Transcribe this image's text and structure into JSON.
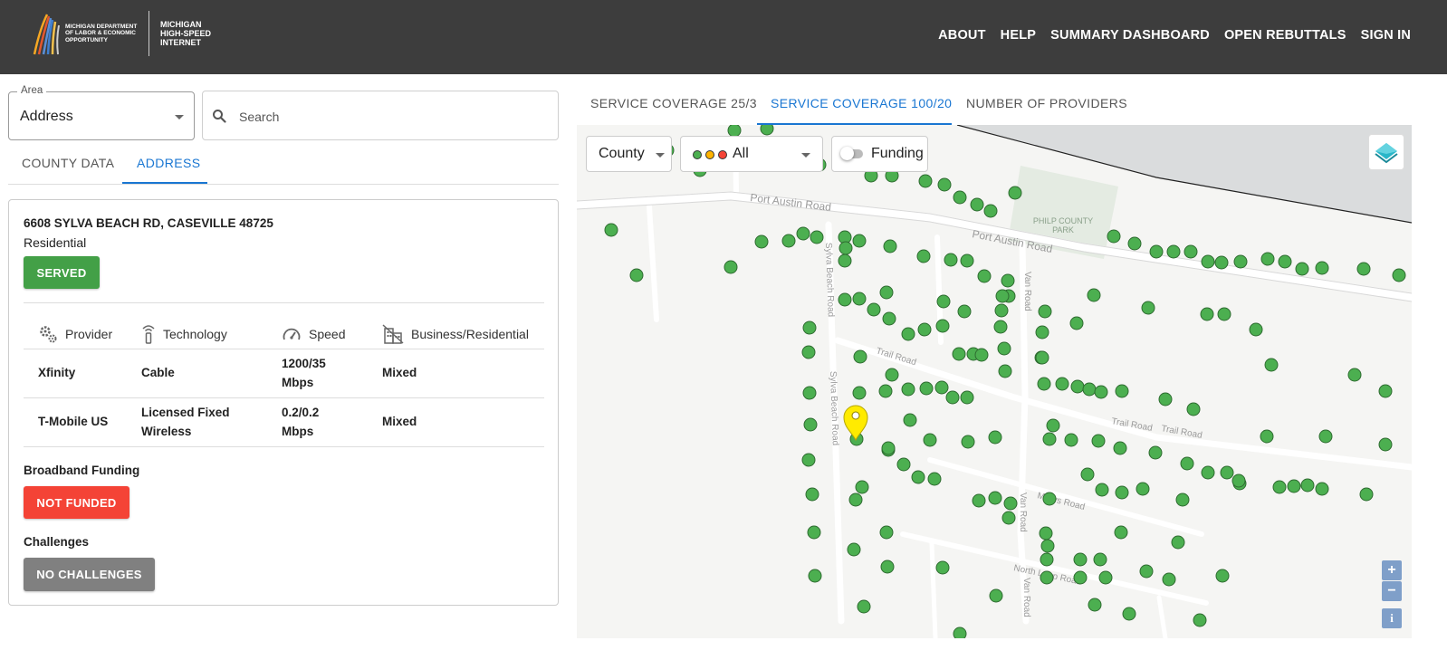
{
  "header": {
    "logo_text_left": "MICHIGAN DEPARTMENT OF LABOR & ECONOMIC OPPORTUNITY",
    "logo_text_right": [
      "MICHIGAN",
      "HIGH-SPEED",
      "INTERNET"
    ],
    "nav": [
      "ABOUT",
      "HELP",
      "SUMMARY DASHBOARD",
      "OPEN REBUTTALS",
      "SIGN IN"
    ]
  },
  "left": {
    "area_label": "Area",
    "area_value": "Address",
    "search_placeholder": "Search",
    "tabs": [
      "COUNTY DATA",
      "ADDRESS"
    ],
    "active_tab": "ADDRESS",
    "card": {
      "address": "6608 SYLVA BEACH RD, CASEVILLE 48725",
      "type": "Residential",
      "status": "SERVED",
      "columns": [
        "Provider",
        "Technology",
        "Speed",
        "Business/Residential"
      ],
      "rows": [
        {
          "provider": "Xfinity",
          "technology": "Cable",
          "speed_1": "1200/35",
          "speed_2": "Mbps",
          "use": "Mixed"
        },
        {
          "provider": "T-Mobile US",
          "technology_1": "Licensed Fixed",
          "technology_2": "Wireless",
          "speed_1": "0.2/0.2",
          "speed_2": "Mbps",
          "use": "Mixed"
        }
      ],
      "funding_title": "Broadband Funding",
      "funding_status": "NOT FUNDED",
      "challenges_title": "Challenges",
      "challenges_status": "NO CHALLENGES"
    }
  },
  "right": {
    "tabs": [
      "SERVICE COVERAGE 25/3",
      "SERVICE COVERAGE 100/20",
      "NUMBER OF PROVIDERS"
    ],
    "active_tab": "SERVICE COVERAGE 100/20",
    "map": {
      "county_select": "County",
      "status_filter": "All",
      "funding_toggle_label": "Funding",
      "funding_toggle_on": false,
      "zoom_in": "+",
      "zoom_out": "−",
      "info": "i",
      "park_label": [
        "PHILP COUNTY",
        "PARK"
      ],
      "streets": {
        "port_austin_1": "Port Austin Road",
        "port_austin_2": "Port Austin Road",
        "sylva_1": "Sylva Beach Road",
        "sylva_2": "Sylva Beach Road",
        "van_1": "Van Road",
        "van_2": "Van Road",
        "van_3": "Van Road",
        "trail_1": "Trail Road",
        "trail_2": "Trail Road",
        "trail_3": "Trail Road",
        "marys": "Marys Road",
        "north_loop": "North Loop Road"
      }
    }
  },
  "colors": {
    "header_bg": "#3d3d3d",
    "accent": "#1976d2",
    "served": "#43a047",
    "not_funded": "#f44336",
    "no_challenges": "#808080",
    "point": "#4caf50",
    "pin": "#ffeb00"
  }
}
